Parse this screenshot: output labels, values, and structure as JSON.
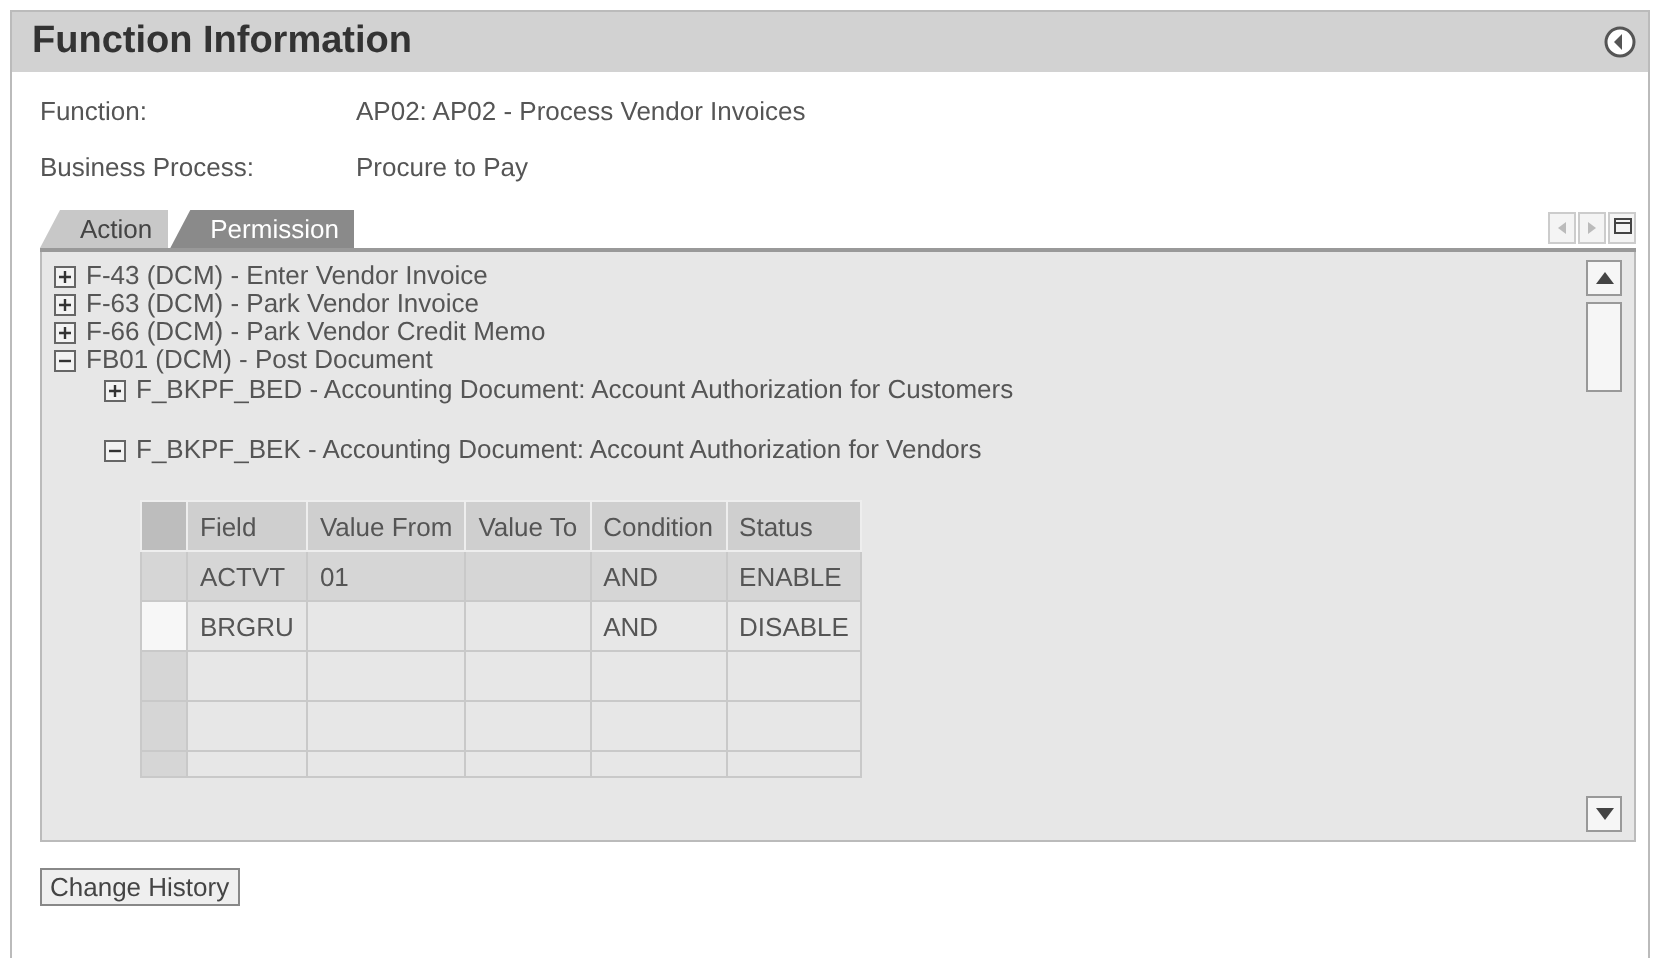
{
  "header": {
    "title": "Function Information"
  },
  "fields": [
    {
      "label": "Function:",
      "value": "AP02: AP02 - Process Vendor Invoices"
    },
    {
      "label": "Business Process:",
      "value": "Procure to Pay"
    }
  ],
  "tabs": [
    {
      "label": "Action",
      "selected": false
    },
    {
      "label": "Permission",
      "selected": true
    }
  ],
  "tree": [
    {
      "label": "F-43 (DCM) - Enter Vendor Invoice",
      "expanded": false
    },
    {
      "label": "F-63 (DCM) - Park Vendor Invoice",
      "expanded": false
    },
    {
      "label": "F-66 (DCM) - Park Vendor Credit Memo",
      "expanded": false
    },
    {
      "label": "FB01 (DCM) - Post Document",
      "expanded": true,
      "children": [
        {
          "label": "F_BKPF_BED - Accounting Document: Account Authorization for Customers",
          "expanded": false
        },
        {
          "label": "F_BKPF_BEK - Accounting Document: Account Authorization for Vendors",
          "expanded": true,
          "table": {
            "columns": [
              "Field",
              "Value From",
              "Value To",
              "Condition",
              "Status"
            ],
            "rows": [
              {
                "selected": true,
                "cells": [
                  "ACTVT",
                  "01",
                  "",
                  "AND",
                  "ENABLE"
                ]
              },
              {
                "selected": false,
                "cells": [
                  "BRGRU",
                  "",
                  "",
                  "AND",
                  "DISABLE"
                ]
              }
            ]
          }
        }
      ]
    }
  ],
  "buttons": [
    "Change History"
  ]
}
